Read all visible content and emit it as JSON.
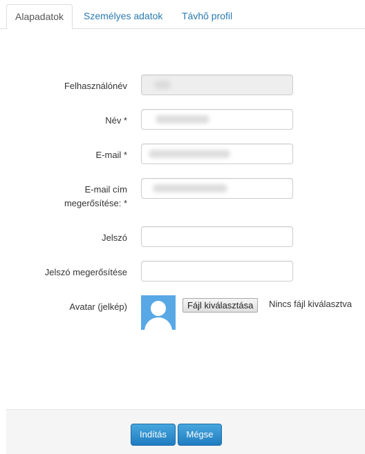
{
  "tabs": [
    {
      "label": "Alapadatok"
    },
    {
      "label": "Személyes adatok"
    },
    {
      "label": "Távhõ profil"
    }
  ],
  "form": {
    "username": {
      "label": "Felhasználónév"
    },
    "name": {
      "label": "Név *"
    },
    "email": {
      "label": "E-mail *"
    },
    "email_confirm": {
      "label_line1": "E-mail cím",
      "label_line2": "megerősítése: *"
    },
    "password": {
      "label": "Jelszó"
    },
    "password_confirm": {
      "label": "Jelszó megerősítése"
    },
    "avatar": {
      "label": "Avatar (jelkép)",
      "file_button": "Fájl kiválasztása",
      "file_status": "Nincs fájl kiválasztva"
    }
  },
  "footer": {
    "submit_label": "Indítás",
    "cancel_label": "Mégse"
  },
  "colors": {
    "accent": "#2a7ab0",
    "button": "#2d8bce",
    "avatar_bg": "#59a8e6"
  }
}
